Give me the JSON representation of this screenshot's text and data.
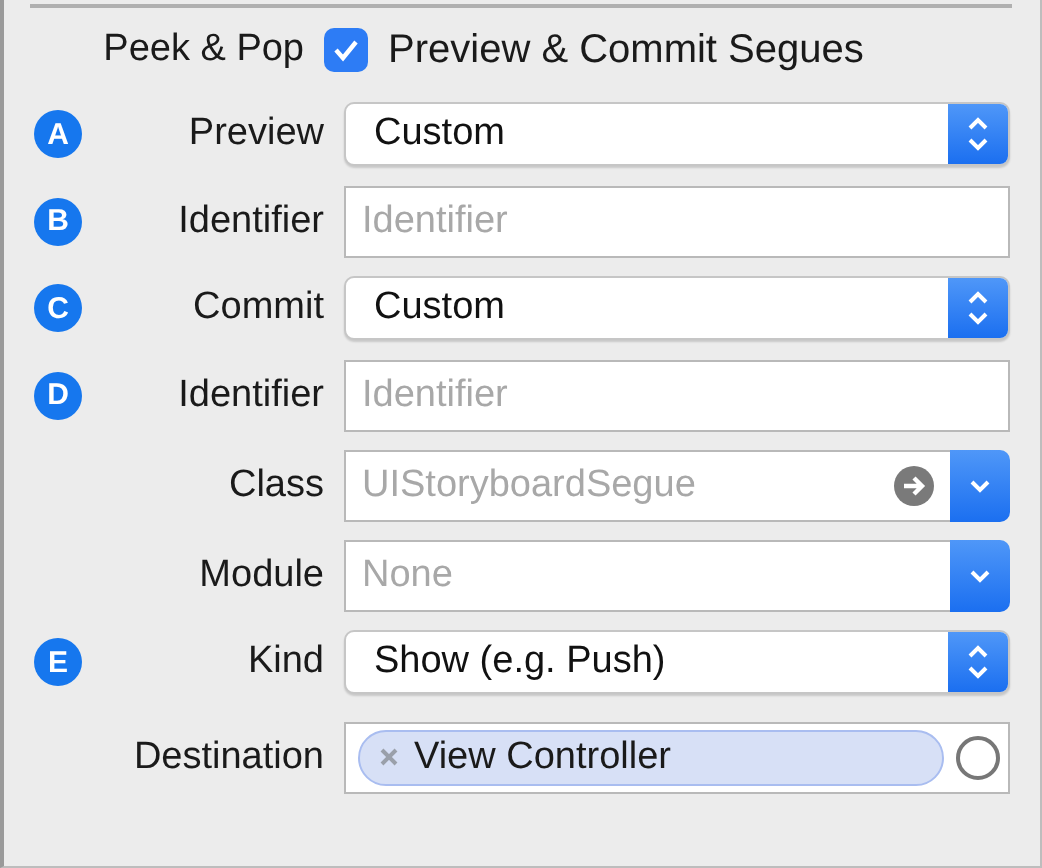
{
  "peek_pop": {
    "label": "Peek & Pop",
    "checked": true,
    "checkbox_label": "Preview & Commit Segues"
  },
  "rows": [
    {
      "badge": "A",
      "label": "Preview",
      "kind": "popup",
      "value": "Custom"
    },
    {
      "badge": "B",
      "label": "Identifier",
      "kind": "text",
      "placeholder": "Identifier"
    },
    {
      "badge": "C",
      "label": "Commit",
      "kind": "popup",
      "value": "Custom"
    },
    {
      "badge": "D",
      "label": "Identifier",
      "kind": "text",
      "placeholder": "Identifier"
    },
    {
      "label": "Class",
      "kind": "combo",
      "placeholder": "UIStoryboardSegue"
    },
    {
      "label": "Module",
      "kind": "dropdown",
      "placeholder": "None"
    },
    {
      "badge": "E",
      "label": "Kind",
      "kind": "popup",
      "value": "Show (e.g. Push)"
    },
    {
      "label": "Destination",
      "kind": "token",
      "token": "View Controller"
    }
  ]
}
